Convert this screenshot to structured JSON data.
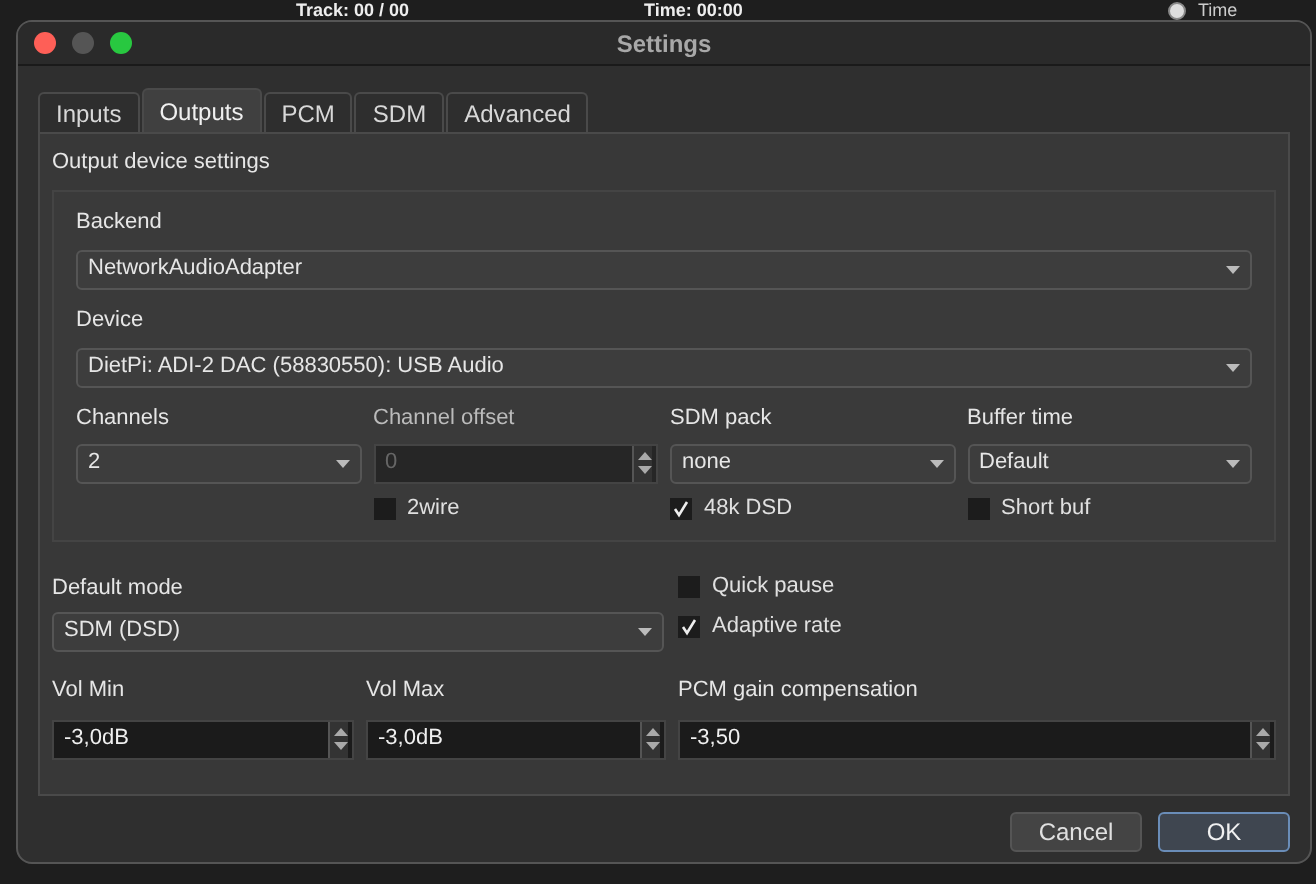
{
  "background": {
    "track": "Track: 00 / 00",
    "time": "Time: 00:00",
    "radio": {
      "label": "Time",
      "selected": true
    }
  },
  "window": {
    "title": "Settings"
  },
  "tabs": [
    {
      "label": "Inputs",
      "selected": false
    },
    {
      "label": "Outputs",
      "selected": true
    },
    {
      "label": "PCM",
      "selected": false
    },
    {
      "label": "SDM",
      "selected": false
    },
    {
      "label": "Advanced",
      "selected": false
    }
  ],
  "output_device": {
    "title": "Output device settings",
    "backend": {
      "label": "Backend",
      "value": "NetworkAudioAdapter"
    },
    "device": {
      "label": "Device",
      "value": "DietPi: ADI-2 DAC (58830550): USB Audio"
    },
    "columns": [
      {
        "label": "Channels",
        "kind": "combo",
        "value": "2",
        "disabled": false
      },
      {
        "label": "Channel offset",
        "kind": "spin",
        "value": "0",
        "disabled": true,
        "checkbox": {
          "label": "2wire",
          "checked": false
        }
      },
      {
        "label": "SDM pack",
        "kind": "combo",
        "value": "none",
        "disabled": false,
        "checkbox": {
          "label": "48k DSD",
          "checked": true
        }
      },
      {
        "label": "Buffer time",
        "kind": "combo",
        "value": "Default",
        "disabled": false,
        "checkbox": {
          "label": "Short buf",
          "checked": false
        }
      }
    ]
  },
  "default_mode": {
    "label": "Default mode",
    "value": "SDM (DSD)"
  },
  "options": [
    {
      "label": "Quick pause",
      "checked": false
    },
    {
      "label": "Adaptive rate",
      "checked": true
    }
  ],
  "spins": [
    {
      "label": "Vol Min",
      "value": "-3,0dB"
    },
    {
      "label": "Vol Max",
      "value": "-3,0dB"
    },
    {
      "label": "PCM gain compensation",
      "value": "-3,50"
    }
  ],
  "buttons": [
    {
      "label": "Cancel",
      "default": false
    },
    {
      "label": "OK",
      "default": true
    }
  ]
}
